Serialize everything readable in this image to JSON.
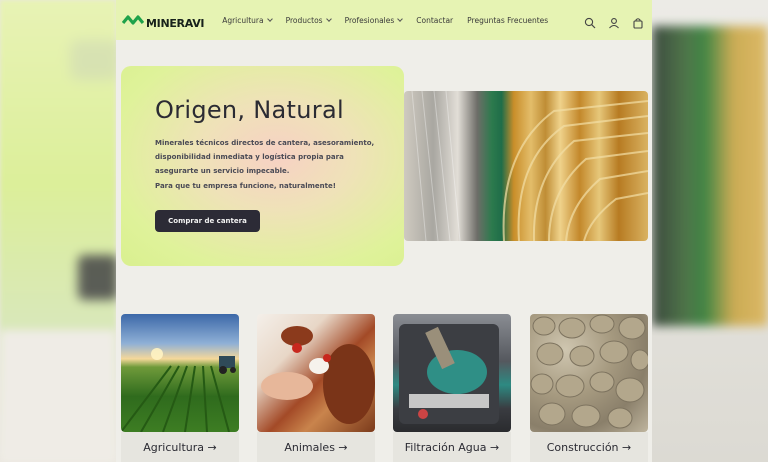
{
  "header": {
    "logo_text": "MINERAVI",
    "nav": [
      {
        "label": "Agricultura",
        "has_dropdown": true
      },
      {
        "label": "Productos",
        "has_dropdown": true
      },
      {
        "label": "Profesionales",
        "has_dropdown": true
      },
      {
        "label": "Contactar",
        "has_dropdown": false
      },
      {
        "label": "Preguntas Frecuentes",
        "has_dropdown": false
      }
    ],
    "icons": [
      "search-icon",
      "account-icon",
      "cart-icon"
    ]
  },
  "hero": {
    "title": "Origen, Natural",
    "description": "Minerales técnicos directos de cantera, asesoramiento, disponibilidad inmediata y logística propia para asegurarte un servicio impecable.",
    "tagline": "Para que tu empresa funcione, naturalmente!",
    "cta_label": "Comprar de cantera"
  },
  "categories": [
    {
      "label": "Agricultura →"
    },
    {
      "label": "Animales →"
    },
    {
      "label": "Filtración Agua →"
    },
    {
      "label": "Construcción →"
    }
  ],
  "colors": {
    "header_bg": "#e6f3b3",
    "accent_green": "#1fa24a",
    "button_bg": "#2c2b36",
    "hero_gradient_green": "#d9f08f",
    "hero_gradient_peach": "#f7d1c4"
  }
}
